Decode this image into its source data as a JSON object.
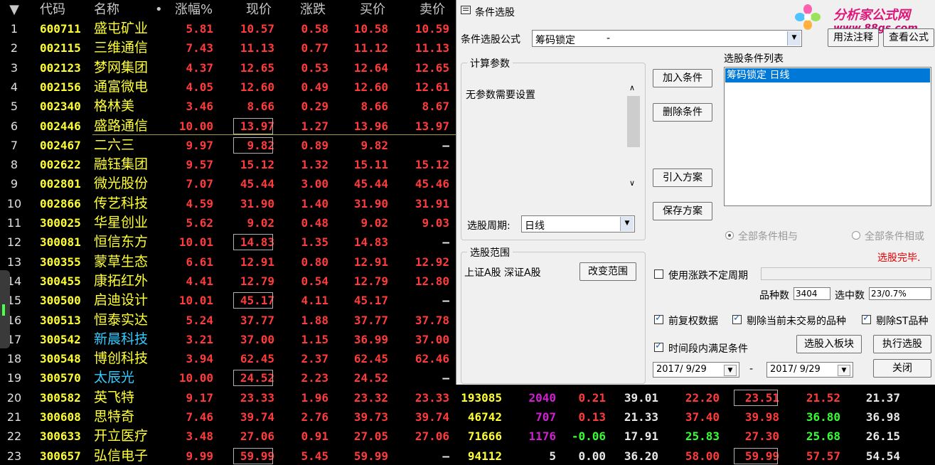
{
  "columns": {
    "idx": "▼",
    "code": "代码",
    "name": "名称",
    "dot": "•",
    "chg": "涨幅%",
    "price": "现价",
    "diff": "涨跌",
    "buy": "买价",
    "sell": "卖价"
  },
  "rows": [
    {
      "idx": "1",
      "code": "600711",
      "name": "盛屯矿业",
      "chg": "5.81",
      "price": "10.57",
      "diff": "0.58",
      "buy": "10.58",
      "sell": "10.59"
    },
    {
      "idx": "2",
      "code": "002115",
      "name": "三维通信",
      "chg": "7.43",
      "price": "11.13",
      "diff": "0.77",
      "buy": "11.12",
      "sell": "11.13"
    },
    {
      "idx": "3",
      "code": "002123",
      "name": "梦网集团",
      "chg": "4.37",
      "price": "12.65",
      "diff": "0.53",
      "buy": "12.64",
      "sell": "12.65"
    },
    {
      "idx": "4",
      "code": "002156",
      "name": "通富微电",
      "chg": "4.05",
      "price": "12.60",
      "diff": "0.49",
      "buy": "12.60",
      "sell": "12.61"
    },
    {
      "idx": "5",
      "code": "002340",
      "name": "格林美",
      "chg": "3.46",
      "price": "8.66",
      "diff": "0.29",
      "buy": "8.66",
      "sell": "8.67"
    },
    {
      "idx": "6",
      "code": "002446",
      "name": "盛路通信",
      "chg": "10.00",
      "price": "13.97",
      "diff": "1.27",
      "buy": "13.96",
      "sell": "13.97",
      "boxed": true
    },
    {
      "idx": "7",
      "code": "002467",
      "name": "二六三",
      "chg": "9.97",
      "price": "9.82",
      "diff": "0.89",
      "buy": "9.82",
      "sell": "—",
      "boxed": true
    },
    {
      "idx": "8",
      "code": "002622",
      "name": "融钰集团",
      "chg": "9.57",
      "price": "15.12",
      "diff": "1.32",
      "buy": "15.11",
      "sell": "15.12"
    },
    {
      "idx": "9",
      "code": "002801",
      "name": "微光股份",
      "chg": "7.07",
      "price": "45.44",
      "diff": "3.00",
      "buy": "45.44",
      "sell": "45.46"
    },
    {
      "idx": "10",
      "code": "002866",
      "name": "传艺科技",
      "chg": "4.59",
      "price": "31.90",
      "diff": "1.40",
      "buy": "31.90",
      "sell": "31.91"
    },
    {
      "idx": "11",
      "code": "300025",
      "name": "华星创业",
      "chg": "5.62",
      "price": "9.02",
      "diff": "0.48",
      "buy": "9.02",
      "sell": "9.03"
    },
    {
      "idx": "12",
      "code": "300081",
      "name": "恒信东方",
      "chg": "10.01",
      "price": "14.83",
      "diff": "1.35",
      "buy": "14.83",
      "sell": "—",
      "boxed": true
    },
    {
      "idx": "13",
      "code": "300355",
      "name": "蒙草生态",
      "chg": "6.61",
      "price": "12.91",
      "diff": "0.80",
      "buy": "12.91",
      "sell": "12.92"
    },
    {
      "idx": "14",
      "code": "300455",
      "name": "康拓红外",
      "chg": "4.41",
      "price": "12.79",
      "diff": "0.54",
      "buy": "12.79",
      "sell": "12.80"
    },
    {
      "idx": "15",
      "code": "300500",
      "name": "启迪设计",
      "chg": "10.01",
      "price": "45.17",
      "diff": "4.11",
      "buy": "45.17",
      "sell": "—",
      "boxed": true
    },
    {
      "idx": "16",
      "code": "300513",
      "name": "恒泰实达",
      "chg": "5.24",
      "price": "37.77",
      "diff": "1.88",
      "buy": "37.77",
      "sell": "37.78"
    },
    {
      "idx": "17",
      "code": "300542",
      "name": "新晨科技",
      "chg": "3.21",
      "price": "37.00",
      "diff": "1.15",
      "buy": "36.99",
      "sell": "37.00",
      "nameColor": "cyan"
    },
    {
      "idx": "18",
      "code": "300548",
      "name": "博创科技",
      "chg": "3.94",
      "price": "62.45",
      "diff": "2.37",
      "buy": "62.45",
      "sell": "62.46"
    },
    {
      "idx": "19",
      "code": "300570",
      "name": "太辰光",
      "chg": "10.00",
      "price": "24.52",
      "diff": "2.23",
      "buy": "24.52",
      "sell": "—",
      "boxed": true,
      "nameColor": "cyan"
    },
    {
      "idx": "20",
      "code": "300582",
      "name": "英飞特",
      "chg": "9.17",
      "price": "23.33",
      "diff": "1.96",
      "buy": "23.32",
      "sell": "23.33",
      "extra": [
        {
          "v": "193085",
          "c": "yellow"
        },
        {
          "v": "2040",
          "c": "magenta"
        },
        {
          "v": "0.21",
          "c": "red"
        },
        {
          "v": "39.01",
          "c": "white"
        },
        {
          "v": "22.20",
          "c": "red"
        },
        {
          "v": "23.51",
          "c": "red",
          "boxed": true
        },
        {
          "v": "21.52",
          "c": "red"
        },
        {
          "v": "21.37",
          "c": "white"
        }
      ]
    },
    {
      "idx": "21",
      "code": "300608",
      "name": "思特奇",
      "chg": "7.46",
      "price": "39.74",
      "diff": "2.76",
      "buy": "39.73",
      "sell": "39.74",
      "extra": [
        {
          "v": "46742",
          "c": "yellow"
        },
        {
          "v": "707",
          "c": "magenta"
        },
        {
          "v": "0.13",
          "c": "red"
        },
        {
          "v": "21.33",
          "c": "white"
        },
        {
          "v": "37.40",
          "c": "red"
        },
        {
          "v": "39.98",
          "c": "red"
        },
        {
          "v": "36.80",
          "c": "green"
        },
        {
          "v": "36.98",
          "c": "white"
        }
      ]
    },
    {
      "idx": "22",
      "code": "300633",
      "name": "开立医疗",
      "chg": "3.48",
      "price": "27.06",
      "diff": "0.91",
      "buy": "27.05",
      "sell": "27.06",
      "extra": [
        {
          "v": "71666",
          "c": "yellow"
        },
        {
          "v": "1176",
          "c": "magenta"
        },
        {
          "v": "-0.06",
          "c": "green"
        },
        {
          "v": "17.91",
          "c": "white"
        },
        {
          "v": "25.83",
          "c": "green"
        },
        {
          "v": "27.30",
          "c": "red"
        },
        {
          "v": "25.68",
          "c": "green"
        },
        {
          "v": "26.15",
          "c": "white"
        }
      ]
    },
    {
      "idx": "23",
      "code": "300657",
      "name": "弘信电子",
      "chg": "9.99",
      "price": "59.99",
      "diff": "5.45",
      "buy": "59.99",
      "sell": "—",
      "boxed": true,
      "extra": [
        {
          "v": "94112",
          "c": "yellow"
        },
        {
          "v": "5",
          "c": "white"
        },
        {
          "v": "0.00",
          "c": "white"
        },
        {
          "v": "36.20",
          "c": "white"
        },
        {
          "v": "58.00",
          "c": "red"
        },
        {
          "v": "59.99",
          "c": "red",
          "boxed": true
        },
        {
          "v": "57.57",
          "c": "red"
        },
        {
          "v": "54.54",
          "c": "white"
        }
      ]
    }
  ],
  "dialog": {
    "title": "条件选股",
    "formula_label": "条件选股公式",
    "formula_value": "筹码锁定",
    "formula_dash": "-",
    "btn_usage": "用法注释",
    "btn_view": "查看公式",
    "calc_group": "计算参数",
    "no_params": "无参数需要设置",
    "period_label": "选股周期:",
    "period_value": "日线",
    "btn_add": "加入条件",
    "btn_delete": "删除条件",
    "btn_import": "引入方案",
    "btn_save": "保存方案",
    "list_label": "选股条件列表",
    "list_items": [
      "筹码锁定  日线"
    ],
    "radio_and": "全部条件相与",
    "radio_or": "全部条件相或",
    "status": "选股完毕.",
    "range_group": "选股范围",
    "range_value": "上证A股 深证A股",
    "btn_range": "改变范围",
    "use_period": "使用涨跌不定周期",
    "count_label": "品种数",
    "count_value": "3404",
    "selected_label": "选中数",
    "selected_value": "23/0.7%",
    "chk_prefq": "前复权数据",
    "chk_exclude_untraded": "剔除当前未交易的品种",
    "chk_exclude_st": "剔除ST品种",
    "chk_time_range": "时间段内满足条件",
    "btn_to_block": "选股入板块",
    "btn_execute": "执行选股",
    "date_from": "2017/ 9/29",
    "date_dash": "-",
    "date_to": "2017/ 9/29",
    "btn_close": "关闭"
  },
  "watermark": {
    "line1": "分析家公式网",
    "line2": "www.88gs.com"
  },
  "colors": {
    "up": "#ff3b3b",
    "down": "#33ff33",
    "code": "#ffff33",
    "accent": "#3399ff",
    "status": "#e00000"
  }
}
